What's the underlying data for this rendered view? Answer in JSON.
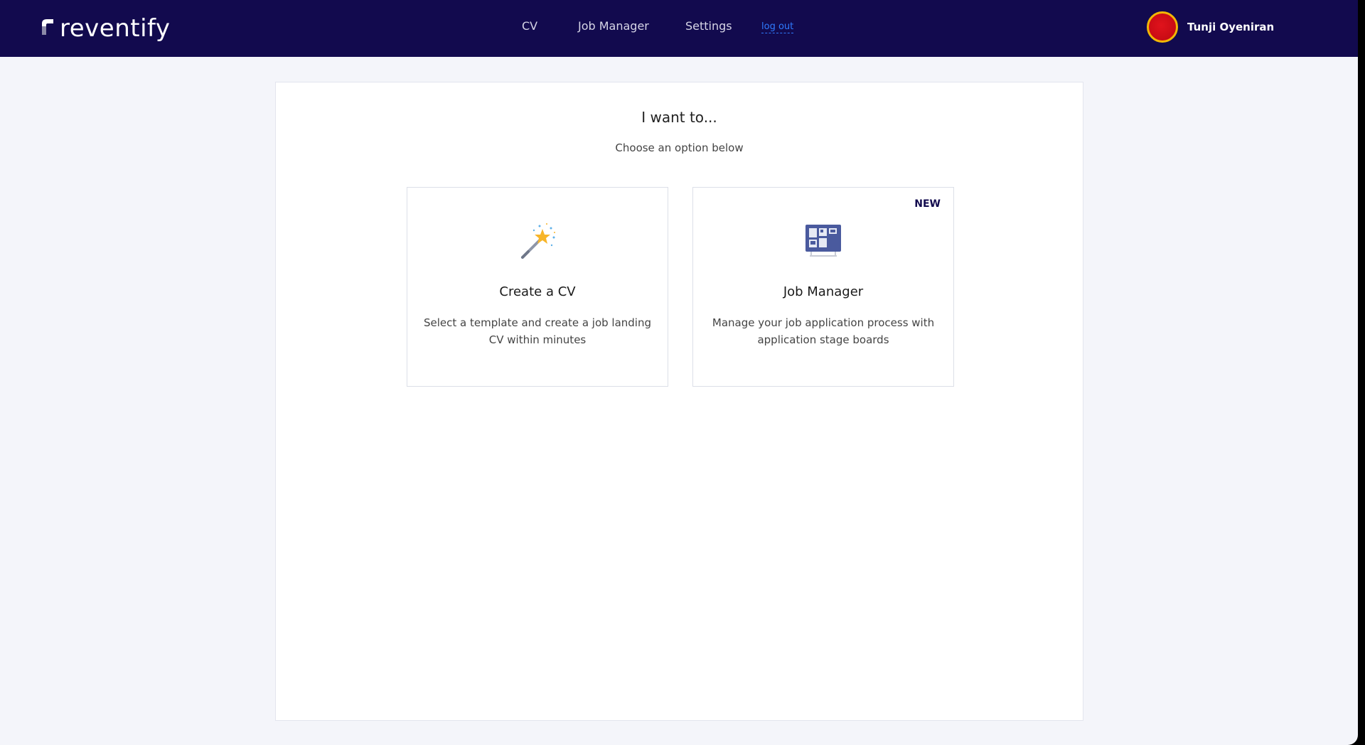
{
  "brand": {
    "name": "reventify",
    "nav_bg": "#120a4e"
  },
  "nav": {
    "cv": "CV",
    "job_manager": "Job Manager",
    "settings": "Settings",
    "logout": "log out"
  },
  "user": {
    "name": "Tunji Oyeniran",
    "avatar_color": "#d01018"
  },
  "main": {
    "heading": "I want to...",
    "subheading": "Choose an option below",
    "cards": [
      {
        "icon": "magic-wand-icon",
        "title": "Create a CV",
        "description": "Select a template and create a job landing CV within minutes"
      },
      {
        "icon": "kanban-board-icon",
        "badge": "NEW",
        "title": "Job Manager",
        "description": "Manage your job application process with application stage boards"
      }
    ]
  }
}
